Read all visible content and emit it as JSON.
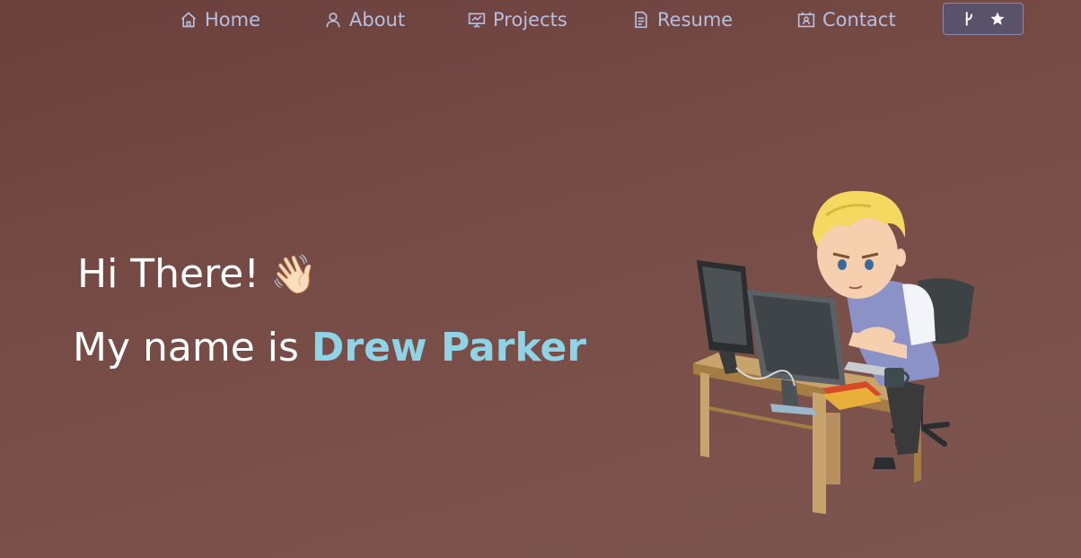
{
  "nav": {
    "items": [
      {
        "label": "Home",
        "icon": "home-icon"
      },
      {
        "label": "About",
        "icon": "user-icon"
      },
      {
        "label": "Projects",
        "icon": "presentation-icon"
      },
      {
        "label": "Resume",
        "icon": "document-icon"
      },
      {
        "label": "Contact",
        "icon": "contact-card-icon"
      }
    ],
    "github_button": {
      "icons": [
        "git-fork-icon",
        "star-icon"
      ]
    }
  },
  "hero": {
    "greeting": "Hi There!",
    "wave_emoji": "👋🏻",
    "intro_prefix": "My name is",
    "name": "Drew Parker"
  },
  "colors": {
    "nav_text": "#b8bede",
    "name_accent": "#8fd3e6",
    "button_bg": "#59526a"
  }
}
